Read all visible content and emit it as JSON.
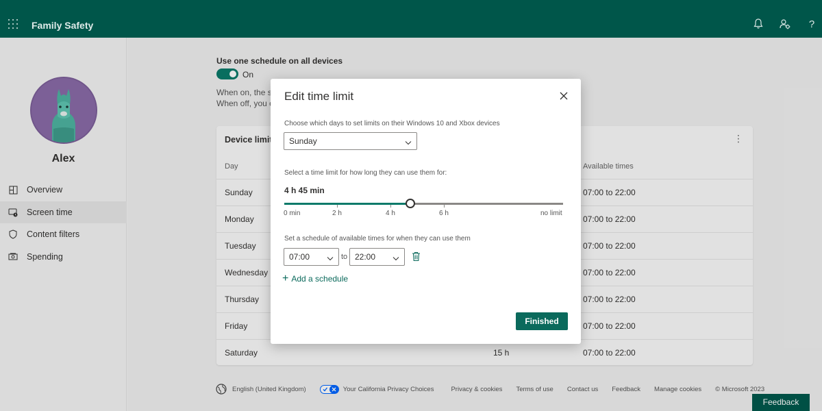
{
  "app": {
    "title": "Family Safety"
  },
  "topbar": {
    "icons": [
      "bell-icon",
      "manage-family-icon",
      "help-icon"
    ],
    "help_glyph": "?"
  },
  "sidebar": {
    "user_name": "Alex",
    "items": [
      {
        "label": "Overview",
        "icon": "overview-icon",
        "active": false
      },
      {
        "label": "Screen time",
        "icon": "screen-time-icon",
        "active": true
      },
      {
        "label": "Content filters",
        "icon": "shield-icon",
        "active": false
      },
      {
        "label": "Spending",
        "icon": "spending-icon",
        "active": false
      }
    ]
  },
  "main": {
    "schedule_label": "Use one schedule on all devices",
    "toggle_label": "On",
    "toggle_state": true,
    "desc_line1": "When on, the se",
    "desc_line2": "When off, you c",
    "card": {
      "title": "Device limits",
      "col_day": "Day",
      "col_available": "Available times",
      "rows": [
        {
          "day": "Sunday",
          "limit": "",
          "available": "07:00 to 22:00"
        },
        {
          "day": "Monday",
          "limit": "",
          "available": "07:00 to 22:00"
        },
        {
          "day": "Tuesday",
          "limit": "",
          "available": "07:00 to 22:00"
        },
        {
          "day": "Wednesday",
          "limit": "",
          "available": "07:00 to 22:00"
        },
        {
          "day": "Thursday",
          "limit": "",
          "available": "07:00 to 22:00"
        },
        {
          "day": "Friday",
          "limit": "",
          "available": "07:00 to 22:00"
        },
        {
          "day": "Saturday",
          "limit": "15 h",
          "available": "07:00 to 22:00"
        }
      ]
    }
  },
  "footer": {
    "language": "English (United Kingdom)",
    "privacy_choices": "Your California Privacy Choices",
    "links": [
      "Privacy & cookies",
      "Terms of use",
      "Contact us",
      "Feedback",
      "Manage cookies",
      "© Microsoft 2023"
    ],
    "feedback_button": "Feedback"
  },
  "modal": {
    "title": "Edit time limit",
    "days_label": "Choose which days to set limits on their Windows 10 and Xbox devices",
    "day_selected": "Sunday",
    "limit_label": "Select a time limit for how long they can use them for:",
    "limit_value": "4 h 45 min",
    "slider": {
      "value_fraction": 0.452,
      "ticks": [
        "0 min",
        "2 h",
        "4 h",
        "6 h",
        "no limit"
      ]
    },
    "schedule_label": "Set a schedule of available times for when they can use them",
    "from_time": "07:00",
    "to_word": "to",
    "to_time": "22:00",
    "add_schedule": "Add a schedule",
    "finished_button": "Finished"
  },
  "colors": {
    "brand": "#005a4e",
    "accent": "#0b7a6a"
  }
}
